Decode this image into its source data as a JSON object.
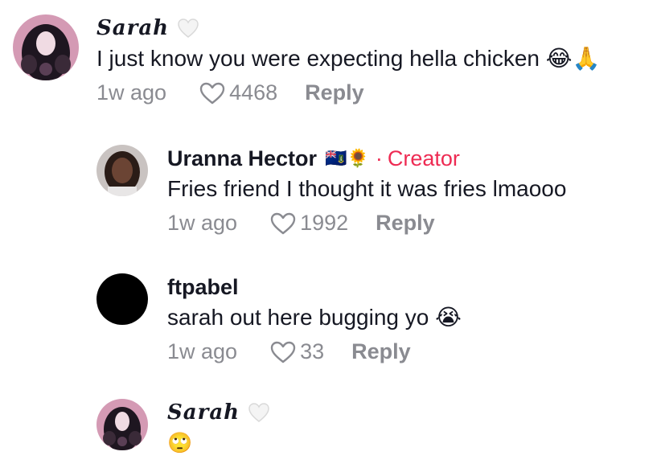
{
  "comments": [
    {
      "name": "Sarah",
      "text": "I just know you were expecting hella chicken 😂🙏",
      "time": "1w ago",
      "likes": "4468",
      "reply": "Reply"
    },
    {
      "name": "Uranna Hector",
      "flags": "🇻🇬🌻",
      "separator": "·",
      "badge": "Creator",
      "text": "Fries friend I thought it was fries lmaooo",
      "time": "1w ago",
      "likes": "1992",
      "reply": "Reply"
    },
    {
      "name": "ftpabel",
      "text": "sarah out here bugging yo 😭",
      "time": "1w ago",
      "likes": "33",
      "reply": "Reply"
    },
    {
      "name": "Sarah",
      "text": "🙄"
    }
  ],
  "colors": {
    "creator_badge": "#ee2b53",
    "meta_gray": "#8a8b91",
    "text": "#161823"
  },
  "icons": {
    "verified_heart": "white-heart-icon",
    "like": "heart-outline-icon"
  }
}
